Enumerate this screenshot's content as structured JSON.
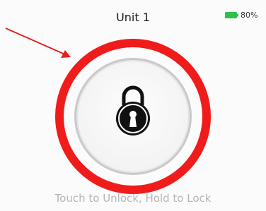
{
  "header": {
    "title": "Unit 1",
    "battery": {
      "level_text": "80%",
      "level": 0.8,
      "color": "#2ec24a"
    }
  },
  "lock_button": {
    "icon": "padlock-icon",
    "state": "locked",
    "highlight_color": "#f01b1b",
    "hint": "Touch to Unlock, Hold to Lock"
  },
  "annotation": {
    "arrow_color": "#e61e1e"
  }
}
